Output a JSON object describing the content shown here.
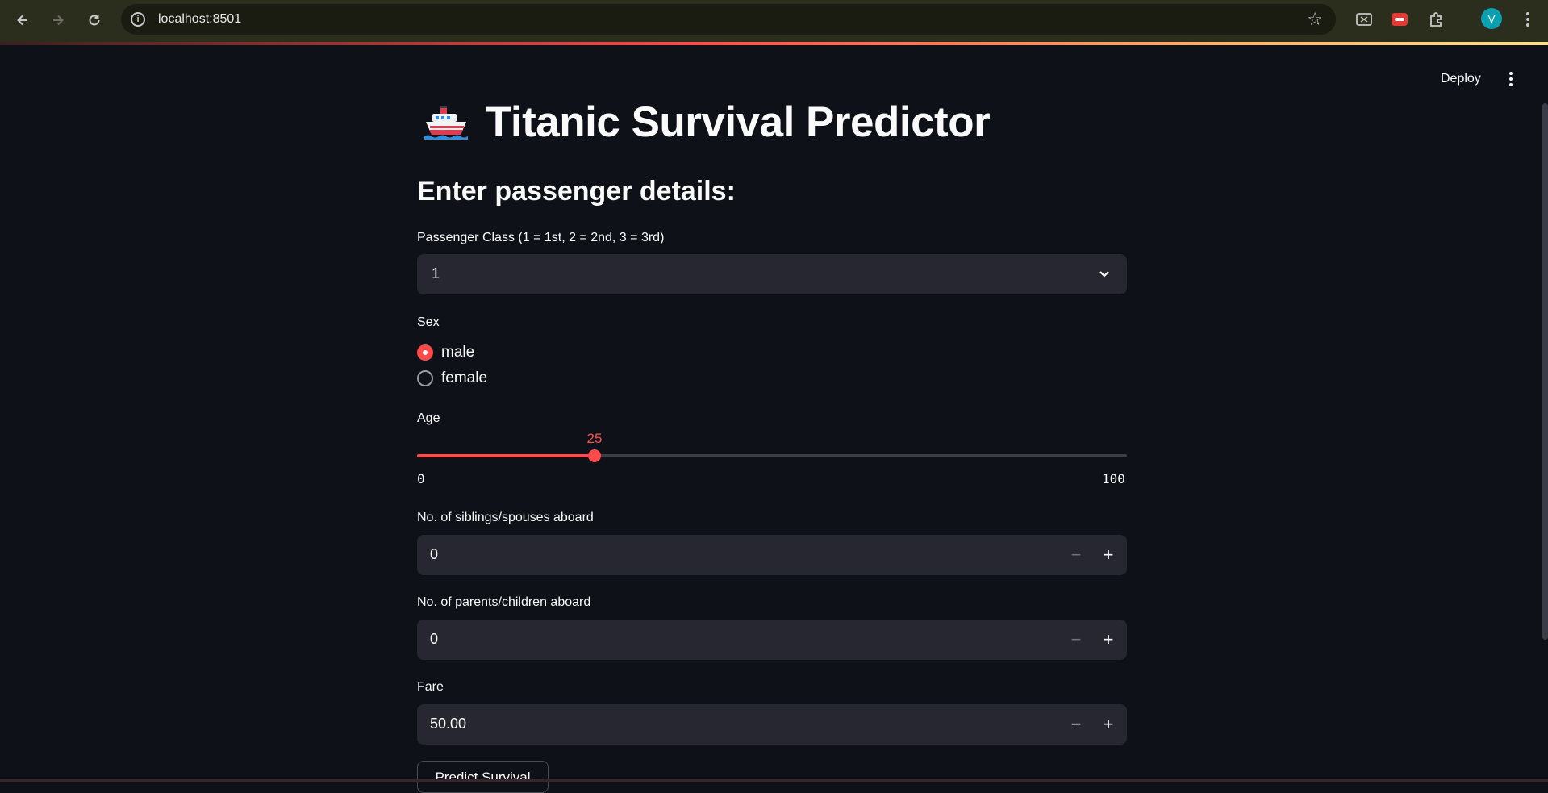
{
  "browser": {
    "url": "localhost:8501",
    "profile_initial": "V"
  },
  "header": {
    "deploy_label": "Deploy"
  },
  "main": {
    "title": "Titanic Survival Predictor",
    "title_icon": "ship-icon",
    "subheader": "Enter passenger details:",
    "pclass": {
      "label": "Passenger Class (1 = 1st, 2 = 2nd, 3 = 3rd)",
      "value": "1"
    },
    "sex": {
      "label": "Sex",
      "options": [
        "male",
        "female"
      ],
      "selected": "male"
    },
    "age": {
      "label": "Age",
      "value": 25,
      "value_text": "25",
      "min": 0,
      "max": 100,
      "min_text": "0",
      "max_text": "100"
    },
    "sibsp": {
      "label": "No. of siblings/spouses aboard",
      "value": "0"
    },
    "parch": {
      "label": "No. of parents/children aboard",
      "value": "0"
    },
    "fare": {
      "label": "Fare",
      "value": "50.00"
    },
    "predict_label": "Predict Survival"
  },
  "colors": {
    "background": "#0e1117",
    "input_bg": "#262730",
    "accent": "#ff4b4b",
    "text": "#fafafa"
  }
}
